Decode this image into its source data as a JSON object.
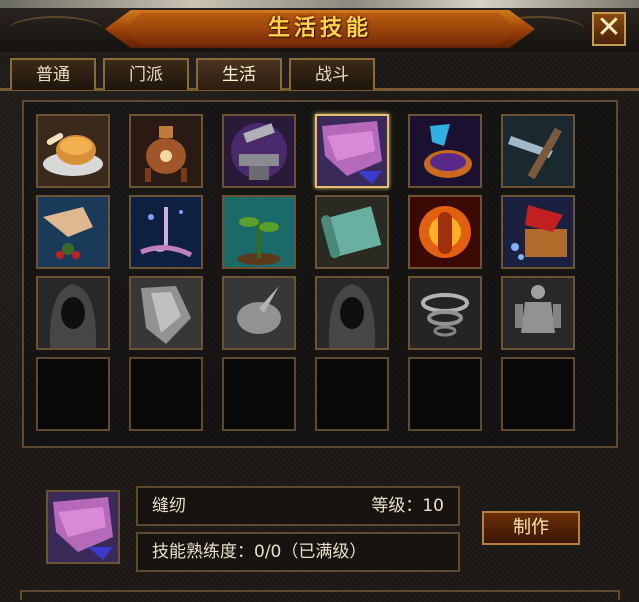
{
  "window": {
    "title": "生活技能",
    "close_glyph": "✕"
  },
  "tabs": [
    {
      "label": "普通",
      "active": false
    },
    {
      "label": "门派",
      "active": false
    },
    {
      "label": "生活",
      "active": true
    },
    {
      "label": "战斗",
      "active": false
    }
  ],
  "skills": [
    {
      "icon": "roast-chicken-icon",
      "enabled": true
    },
    {
      "icon": "alchemy-cauldron-icon",
      "enabled": true
    },
    {
      "icon": "anvil-hammer-icon",
      "enabled": true
    },
    {
      "icon": "tailoring-cloth-icon",
      "enabled": true,
      "selected": true
    },
    {
      "icon": "potion-flask-icon",
      "enabled": true
    },
    {
      "icon": "mining-pickaxe-icon",
      "enabled": true
    },
    {
      "icon": "herb-gathering-icon",
      "enabled": true
    },
    {
      "icon": "fishing-hook-icon",
      "enabled": true
    },
    {
      "icon": "sprout-planting-icon",
      "enabled": true
    },
    {
      "icon": "scroll-icon",
      "enabled": true
    },
    {
      "icon": "fire-aura-icon",
      "enabled": true
    },
    {
      "icon": "book-crafting-icon",
      "enabled": true
    },
    {
      "icon": "hooded-figure-icon",
      "enabled": false
    },
    {
      "icon": "shield-crest-icon",
      "enabled": false
    },
    {
      "icon": "bird-icon",
      "enabled": false
    },
    {
      "icon": "hooded-figure-icon",
      "enabled": false
    },
    {
      "icon": "whirlwind-icon",
      "enabled": false
    },
    {
      "icon": "muscle-statue-icon",
      "enabled": false
    },
    {
      "icon": "empty-slot",
      "enabled": false
    },
    {
      "icon": "empty-slot",
      "enabled": false
    },
    {
      "icon": "empty-slot",
      "enabled": false
    },
    {
      "icon": "empty-slot",
      "enabled": false
    },
    {
      "icon": "empty-slot",
      "enabled": false
    },
    {
      "icon": "empty-slot",
      "enabled": false
    }
  ],
  "selected_skill": {
    "icon": "tailoring-cloth-icon",
    "name": "缝纫",
    "level_label": "等级：10",
    "proficiency_label": "技能熟练度：0/0（已满级）"
  },
  "actions": {
    "make_label": "制作"
  },
  "colors": {
    "accent_gold": "#ffd24a",
    "frame_brown": "#8a6a3a",
    "selected_border": "#e4c070"
  }
}
